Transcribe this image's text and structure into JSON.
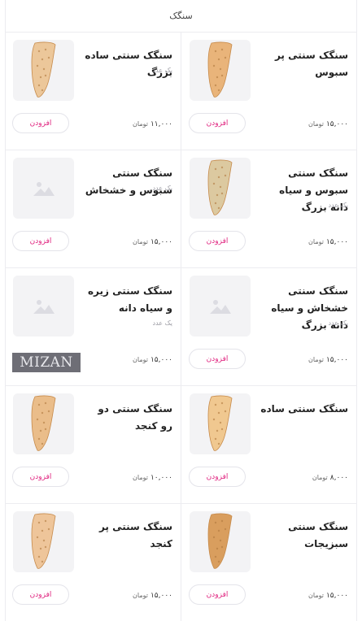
{
  "header": {
    "title": "سنگک"
  },
  "products": [
    {
      "name": "سنگک سنتی پر سبوس",
      "unit": "",
      "price": "۱۵,۰۰۰",
      "currency": "تومان",
      "button": "افزودن",
      "image": "bread",
      "bread_color": "#e9b47a"
    },
    {
      "name": "سنگک سنتی ساده بزرگ",
      "unit": "یک عدد",
      "price": "۱۱,۰۰۰",
      "currency": "تومان",
      "button": "افزودن",
      "image": "bread",
      "bread_color": "#ecc79a"
    },
    {
      "name": "سنگک سنتی سبوس و سیاه دانه بزرگ",
      "unit": "یک عدد",
      "price": "۱۵,۰۰۰",
      "currency": "تومان",
      "button": "افزودن",
      "image": "bread",
      "bread_color": "#dcc9a0"
    },
    {
      "name": "سنگک سنتی سبوس و خشخاش",
      "unit": "یک عدد",
      "price": "۱۵,۰۰۰",
      "currency": "تومان",
      "button": "افزودن",
      "image": "placeholder"
    },
    {
      "name": "سنگک سنتی خشخاش و سیاه دانه بزرگ",
      "unit": "یک عدد",
      "price": "۱۵,۰۰۰",
      "currency": "تومان",
      "button": "افزودن",
      "image": "placeholder"
    },
    {
      "name": "سنگک سنتی زیره و سیاه دانه",
      "unit": "یک عدد",
      "price": "۱۵,۰۰۰",
      "currency": "تومان",
      "button": "",
      "image": "placeholder",
      "watermark": "MIZAN"
    },
    {
      "name": "سنگک سنتی ساده",
      "unit": "",
      "price": "۸,۰۰۰",
      "currency": "تومان",
      "button": "افزودن",
      "image": "bread",
      "bread_color": "#f0c890"
    },
    {
      "name": "سنگک سنتی دو رو کنجد",
      "unit": "",
      "price": "۱۰,۰۰۰",
      "currency": "تومان",
      "button": "افزودن",
      "image": "bread",
      "bread_color": "#eabd8a"
    },
    {
      "name": "سنگک سنتی سبزیجات",
      "unit": "",
      "price": "۱۵,۰۰۰",
      "currency": "تومان",
      "button": "افزودن",
      "image": "bread",
      "bread_color": "#d99e5e"
    },
    {
      "name": "سنگک سنتی پر کنجد",
      "unit": "",
      "price": "۱۵,۰۰۰",
      "currency": "تومان",
      "button": "افزودن",
      "image": "bread",
      "bread_color": "#eec59a"
    }
  ],
  "colors": {
    "accent": "#e0227e",
    "border": "#ececf0",
    "placeholder_bg": "#f3f3f5"
  }
}
